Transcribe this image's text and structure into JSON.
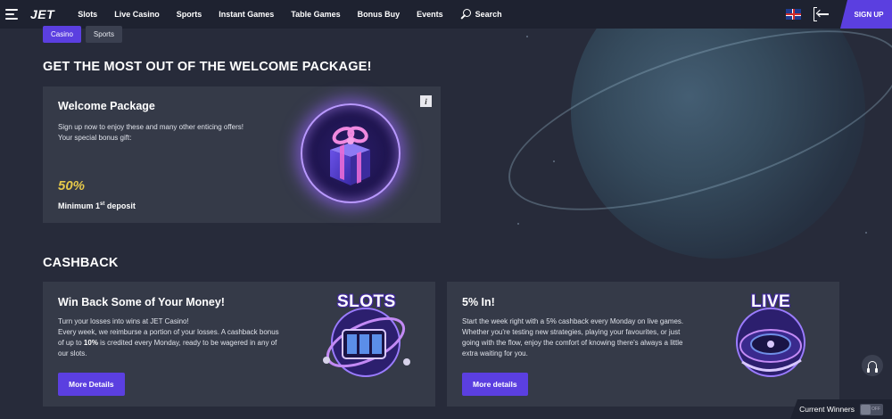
{
  "header": {
    "logo": "JET",
    "nav": [
      "Slots",
      "Live Casino",
      "Sports",
      "Instant Games",
      "Table Games",
      "Bonus Buy",
      "Events"
    ],
    "search_label": "Search",
    "signup_label": "SIGN UP",
    "menu_icon": "hamburger-icon",
    "language_icon": "uk-flag-icon",
    "login_icon": "login-icon",
    "accent_color": "#5b3fe0"
  },
  "tabs": [
    {
      "label": "Casino",
      "active": true
    },
    {
      "label": "Sports",
      "active": false
    }
  ],
  "welcome": {
    "section_title": "GET THE MOST OUT OF THE WELCOME PACKAGE!",
    "card_title": "Welcome Package",
    "text_line1": "Sign up now to enjoy these and many other enticing offers!",
    "text_line2": "Your special bonus gift:",
    "bonus_value": "50%",
    "bonus_note_prefix": "Minimum 1",
    "bonus_note_sup": "st",
    "bonus_note_suffix": " deposit",
    "info_icon_glyph": "i",
    "bonus_color": "#e5c84a"
  },
  "cashback": {
    "section_title": "CASHBACK",
    "cards": [
      {
        "title": "Win Back Some of Your Money!",
        "line1": "Turn your losses into wins at JET Casino!",
        "line2": "Every week, we reimburse a portion of your losses. A cashback bonus of up to ",
        "highlight": "10%",
        "line3": " is credited every Monday, ready to be wagered in any of our slots.",
        "button": "More Details",
        "art_label": "SLOTS"
      },
      {
        "title": "5% In!",
        "text": "Start the week right with a 5% cashback every Monday on live games. Whether you're testing new strategies, playing your favourites, or just going with the flow, enjoy the comfort of knowing there's always a little extra waiting for you.",
        "button": "More details",
        "art_label": "LIVE"
      }
    ]
  },
  "widgets": {
    "support_icon": "headset-icon",
    "current_winners_label": "Current Winners",
    "toggle_label": "OFF"
  }
}
